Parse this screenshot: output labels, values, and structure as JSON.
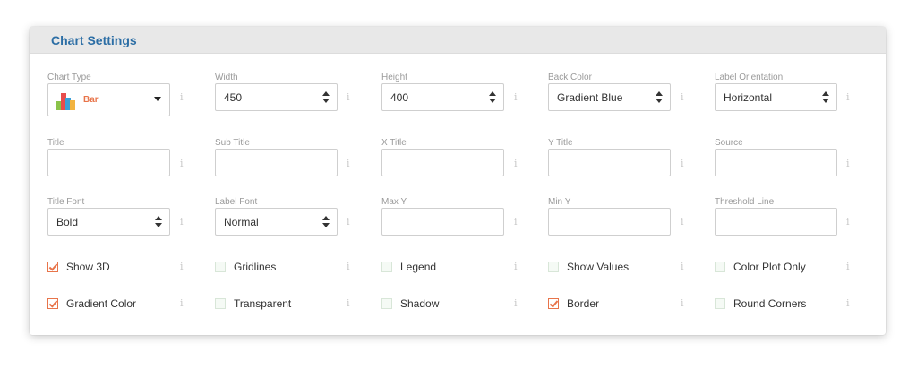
{
  "panel": {
    "title": "Chart Settings"
  },
  "fields": {
    "chart_type": {
      "label": "Chart Type",
      "value": "Bar"
    },
    "width": {
      "label": "Width",
      "value": "450"
    },
    "height": {
      "label": "Height",
      "value": "400"
    },
    "back_color": {
      "label": "Back Color",
      "value": "Gradient Blue"
    },
    "label_orientation": {
      "label": "Label Orientation",
      "value": "Horizontal"
    },
    "title": {
      "label": "Title",
      "value": ""
    },
    "sub_title": {
      "label": "Sub Title",
      "value": ""
    },
    "x_title": {
      "label": "X Title",
      "value": ""
    },
    "y_title": {
      "label": "Y Title",
      "value": ""
    },
    "source": {
      "label": "Source",
      "value": ""
    },
    "title_font": {
      "label": "Title Font",
      "value": "Bold"
    },
    "label_font": {
      "label": "Label Font",
      "value": "Normal"
    },
    "max_y": {
      "label": "Max Y",
      "value": ""
    },
    "min_y": {
      "label": "Min Y",
      "value": ""
    },
    "threshold_line": {
      "label": "Threshold Line",
      "value": ""
    }
  },
  "options": {
    "show_3d": {
      "label": "Show 3D",
      "checked": true
    },
    "gridlines": {
      "label": "Gridlines",
      "checked": false
    },
    "legend": {
      "label": "Legend",
      "checked": false
    },
    "show_values": {
      "label": "Show Values",
      "checked": false
    },
    "color_plot_only": {
      "label": "Color Plot Only",
      "checked": false
    },
    "gradient_color": {
      "label": "Gradient Color",
      "checked": true
    },
    "transparent": {
      "label": "Transparent",
      "checked": false
    },
    "shadow": {
      "label": "Shadow",
      "checked": false
    },
    "border": {
      "label": "Border",
      "checked": true
    },
    "round_corners": {
      "label": "Round Corners",
      "checked": false
    }
  },
  "info_glyph": "i",
  "colors": {
    "accent": "#e8744a",
    "title_blue": "#2c6ea5",
    "header_bg": "#e8e8e8"
  }
}
